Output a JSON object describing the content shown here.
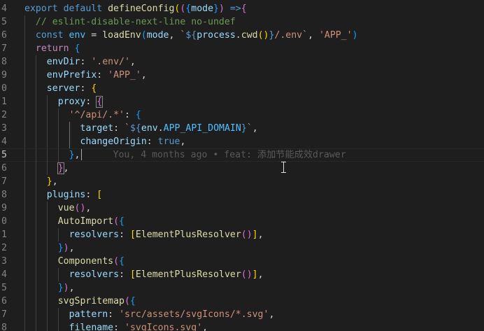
{
  "editor": {
    "active_line": "5",
    "blame": "You, 4 months ago • feat: 添加节能成效drawer",
    "lines": [
      {
        "n": "4",
        "segs": [
          [
            "kw",
            "export "
          ],
          [
            "kw",
            "default "
          ],
          [
            "fn",
            "defineConfig"
          ],
          [
            "b1",
            "("
          ],
          [
            "b2",
            "("
          ],
          [
            "b3",
            "{"
          ],
          [
            "var",
            "mode"
          ],
          [
            "b3",
            "}"
          ],
          [
            "b2",
            ")"
          ],
          [
            "kw",
            " =>"
          ],
          [
            "b2",
            "{"
          ]
        ]
      },
      {
        "n": "5",
        "segs": [
          [
            "cmt",
            "// eslint-disable-next-line no-undef"
          ]
        ]
      },
      {
        "n": "6",
        "segs": [
          [
            "kw",
            "const "
          ],
          [
            "const",
            "env"
          ],
          [
            "txt",
            " = "
          ],
          [
            "fn",
            "loadEnv"
          ],
          [
            "b3",
            "("
          ],
          [
            "var",
            "mode"
          ],
          [
            "txt",
            ", "
          ],
          [
            "tpl",
            "`"
          ],
          [
            "kw",
            "${"
          ],
          [
            "var",
            "process"
          ],
          [
            "txt",
            "."
          ],
          [
            "fn",
            "cwd"
          ],
          [
            "b1",
            "()"
          ],
          [
            "kw",
            "}"
          ],
          [
            "tpl",
            "/.env`"
          ],
          [
            "txt",
            ", "
          ],
          [
            "str",
            "'APP_'"
          ],
          [
            "b3",
            ")"
          ]
        ]
      },
      {
        "n": "7",
        "segs": [
          [
            "ctl",
            "return "
          ],
          [
            "b3",
            "{"
          ]
        ]
      },
      {
        "n": "8",
        "segs": [
          [
            "var",
            "envDir"
          ],
          [
            "txt",
            ": "
          ],
          [
            "str",
            "'.env/'"
          ],
          [
            "txt",
            ","
          ]
        ]
      },
      {
        "n": "9",
        "segs": [
          [
            "var",
            "envPrefix"
          ],
          [
            "txt",
            ": "
          ],
          [
            "str",
            "'APP_'"
          ],
          [
            "txt",
            ","
          ]
        ]
      },
      {
        "n": "0",
        "segs": [
          [
            "var",
            "server"
          ],
          [
            "txt",
            ": "
          ],
          [
            "b1",
            "{"
          ]
        ]
      },
      {
        "n": "1",
        "segs": [
          [
            "var",
            "proxy"
          ],
          [
            "txt",
            ": "
          ],
          [
            "b2",
            "{"
          ]
        ]
      },
      {
        "n": "2",
        "segs": [
          [
            "str",
            "'^/api/.*'"
          ],
          [
            "txt",
            ": "
          ],
          [
            "b3",
            "{"
          ]
        ]
      },
      {
        "n": "3",
        "segs": [
          [
            "var",
            "target"
          ],
          [
            "txt",
            ": "
          ],
          [
            "tpl",
            "`"
          ],
          [
            "kw",
            "${"
          ],
          [
            "var",
            "env"
          ],
          [
            "txt",
            "."
          ],
          [
            "const",
            "APP_API_DOMAIN"
          ],
          [
            "kw",
            "}"
          ],
          [
            "tpl",
            "`"
          ],
          [
            "txt",
            ","
          ]
        ]
      },
      {
        "n": "4",
        "segs": [
          [
            "var",
            "changeOrigin"
          ],
          [
            "txt",
            ": "
          ],
          [
            "kw",
            "true"
          ],
          [
            "txt",
            ","
          ]
        ]
      },
      {
        "n": "5",
        "segs": [
          [
            "b3",
            "}"
          ],
          [
            "txt",
            ","
          ]
        ]
      },
      {
        "n": "6",
        "segs": [
          [
            "b2",
            "}"
          ],
          [
            "txt",
            ","
          ]
        ]
      },
      {
        "n": "7",
        "segs": [
          [
            "b1",
            "}"
          ],
          [
            "txt",
            ","
          ]
        ]
      },
      {
        "n": "8",
        "segs": [
          [
            "var",
            "plugins"
          ],
          [
            "txt",
            ": "
          ],
          [
            "b1",
            "["
          ]
        ]
      },
      {
        "n": "9",
        "segs": [
          [
            "fn",
            "vue"
          ],
          [
            "b2",
            "()"
          ],
          [
            "txt",
            ","
          ]
        ]
      },
      {
        "n": "0",
        "segs": [
          [
            "fn",
            "AutoImport"
          ],
          [
            "b2",
            "("
          ],
          [
            "b3",
            "{"
          ]
        ]
      },
      {
        "n": "1",
        "segs": [
          [
            "var",
            "resolvers"
          ],
          [
            "txt",
            ": "
          ],
          [
            "b1",
            "["
          ],
          [
            "fn",
            "ElementPlusResolver"
          ],
          [
            "b2",
            "()"
          ],
          [
            "b1",
            "]"
          ],
          [
            "txt",
            ","
          ]
        ]
      },
      {
        "n": "2",
        "segs": [
          [
            "b3",
            "}"
          ],
          [
            "b2",
            ")"
          ],
          [
            "txt",
            ","
          ]
        ]
      },
      {
        "n": "3",
        "segs": [
          [
            "fn",
            "Components"
          ],
          [
            "b2",
            "("
          ],
          [
            "b3",
            "{"
          ]
        ]
      },
      {
        "n": "4",
        "segs": [
          [
            "var",
            "resolvers"
          ],
          [
            "txt",
            ": "
          ],
          [
            "b1",
            "["
          ],
          [
            "fn",
            "ElementPlusResolver"
          ],
          [
            "b2",
            "()"
          ],
          [
            "b1",
            "]"
          ],
          [
            "txt",
            ","
          ]
        ]
      },
      {
        "n": "5",
        "segs": [
          [
            "b3",
            "}"
          ],
          [
            "b2",
            ")"
          ],
          [
            "txt",
            ","
          ]
        ]
      },
      {
        "n": "6",
        "segs": [
          [
            "fn",
            "svgSpritemap"
          ],
          [
            "b2",
            "("
          ],
          [
            "b3",
            "{"
          ]
        ]
      },
      {
        "n": "7",
        "segs": [
          [
            "var",
            "pattern"
          ],
          [
            "txt",
            ": "
          ],
          [
            "str",
            "'src/assets/svgIcons/*.svg'"
          ],
          [
            "txt",
            ","
          ]
        ]
      },
      {
        "n": "8",
        "segs": [
          [
            "var",
            "filename"
          ],
          [
            "txt",
            ": "
          ],
          [
            "str",
            "'svgIcons.svg'"
          ],
          [
            "txt",
            ","
          ]
        ]
      }
    ]
  }
}
